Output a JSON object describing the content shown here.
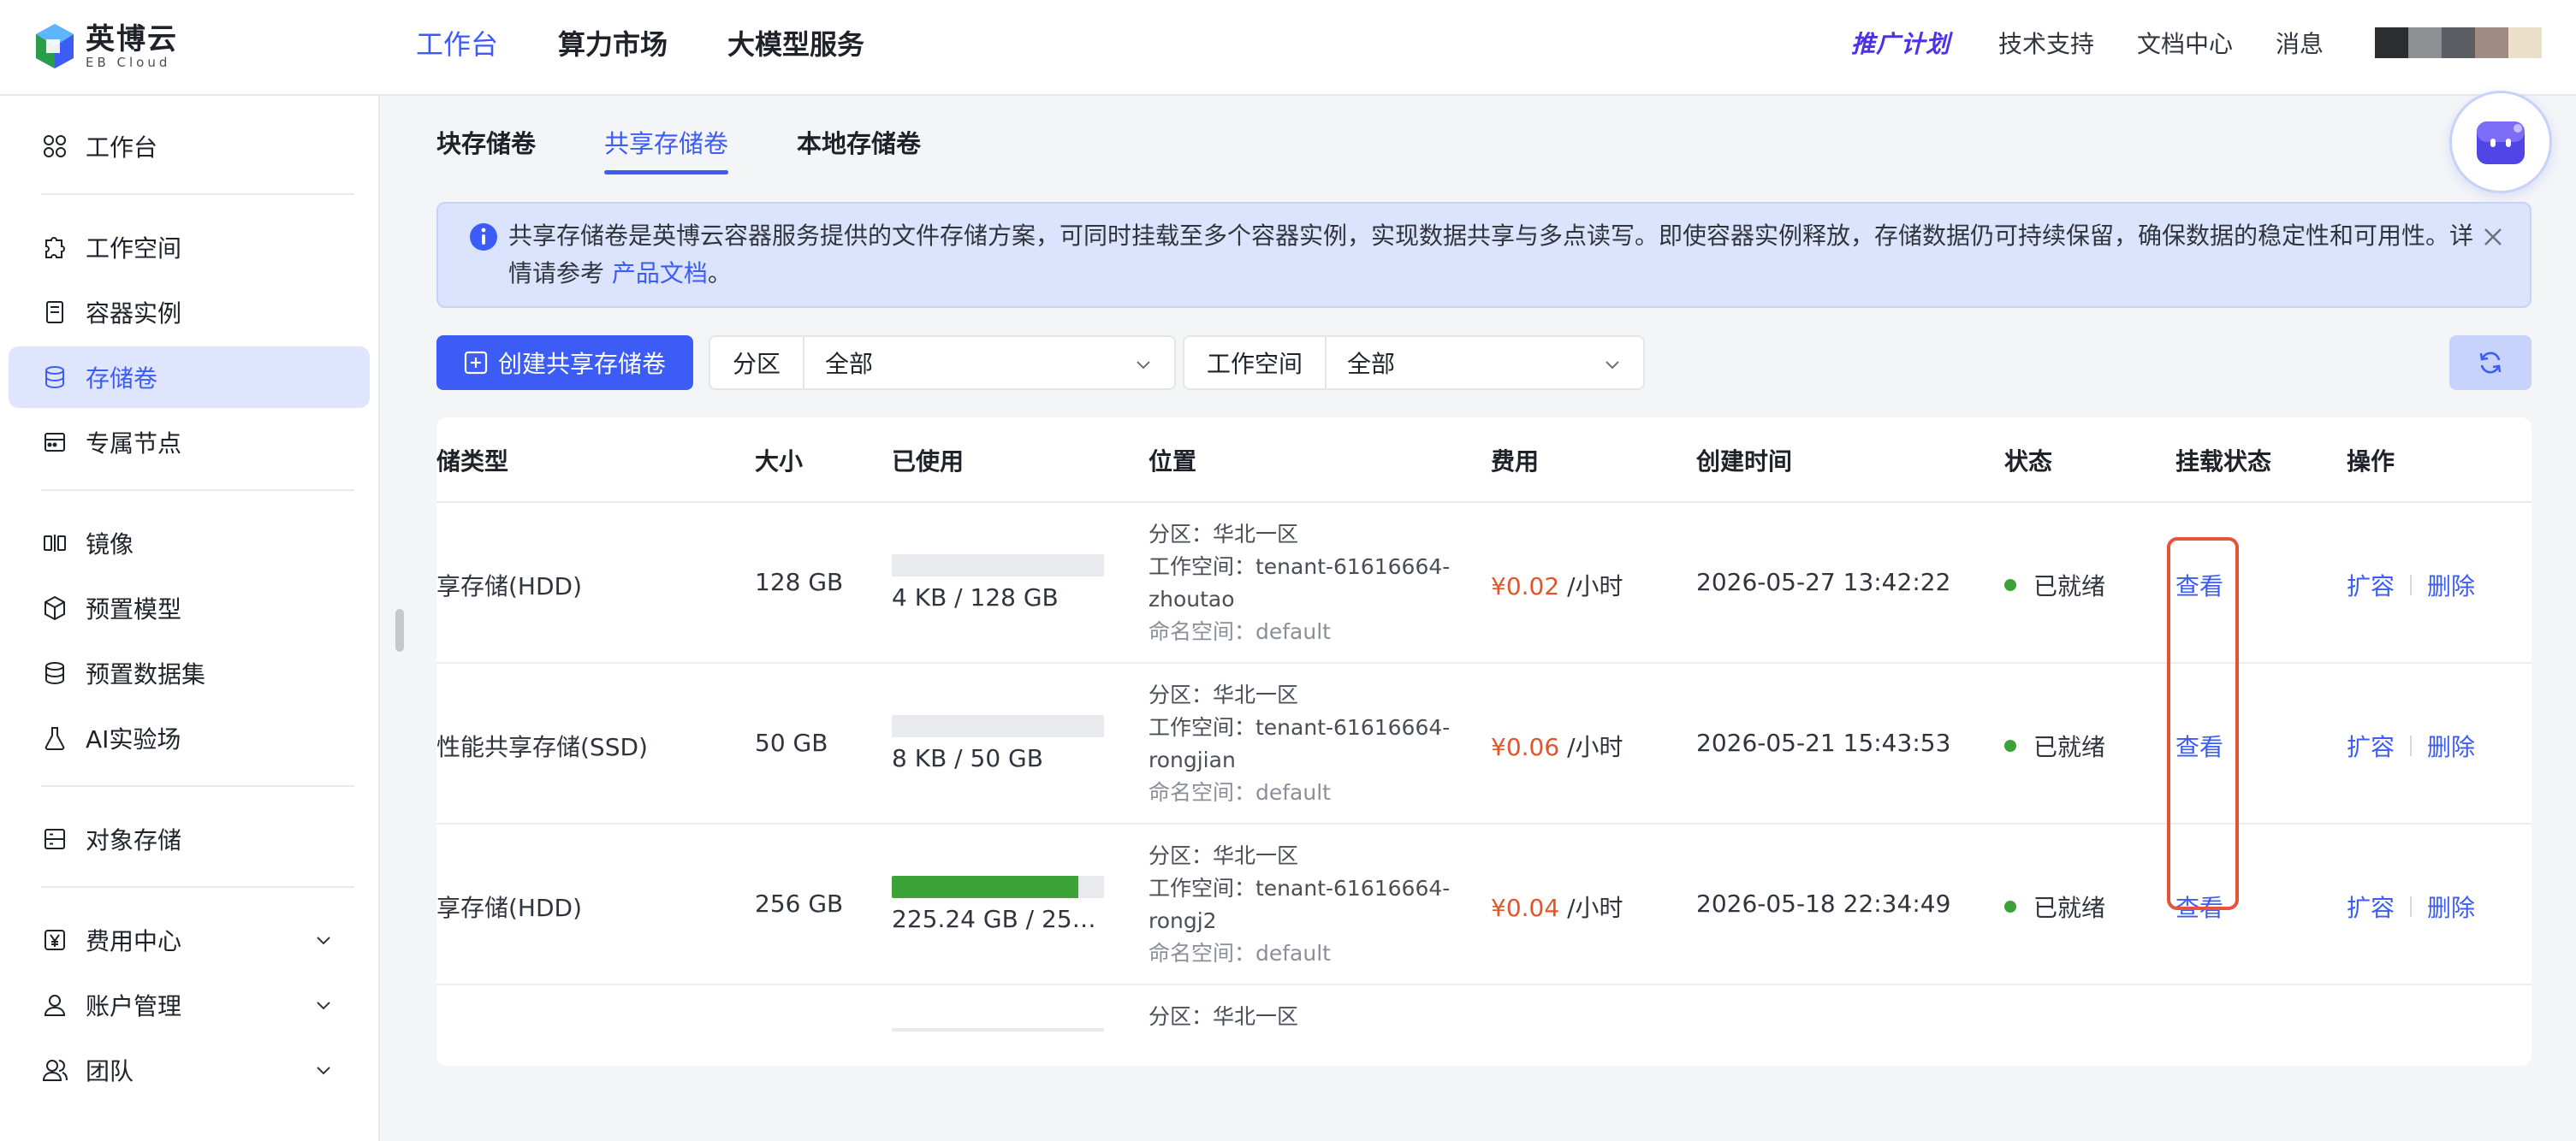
{
  "brand": {
    "name_cn": "英博云",
    "name_en": "EB Cloud",
    "colors": {
      "primary": "#3d5cf5",
      "success": "#3ba338",
      "price": "#e5532c",
      "highlight": "#e5533d"
    }
  },
  "header": {
    "nav": [
      "工作台",
      "算力市场",
      "大模型服务"
    ],
    "promo": "推广计划",
    "links": [
      "技术支持",
      "文档中心",
      "消息"
    ]
  },
  "sidebar": {
    "items": [
      {
        "label": "工作台",
        "icon": "dashboard-icon"
      },
      {
        "label": "工作空间",
        "icon": "puzzle-icon"
      },
      {
        "label": "容器实例",
        "icon": "container-icon"
      },
      {
        "label": "存储卷",
        "icon": "database-icon",
        "active": true
      },
      {
        "label": "专属节点",
        "icon": "node-icon"
      },
      {
        "label": "镜像",
        "icon": "image-icon"
      },
      {
        "label": "预置模型",
        "icon": "cube-icon"
      },
      {
        "label": "预置数据集",
        "icon": "dataset-icon"
      },
      {
        "label": "AI实验场",
        "icon": "flask-icon"
      },
      {
        "label": "对象存储",
        "icon": "object-storage-icon"
      },
      {
        "label": "费用中心",
        "icon": "yen-icon"
      },
      {
        "label": "账户管理",
        "icon": "user-icon"
      },
      {
        "label": "团队",
        "icon": "team-icon"
      }
    ]
  },
  "tabs": [
    "块存储卷",
    "共享存储卷",
    "本地存储卷"
  ],
  "notice": {
    "text": "共享存储卷是英博云容器服务提供的文件存储方案，可同时挂载至多个容器实例，实现数据共享与多点读写。即使容器实例释放，存储数据仍可持续保留，确保数据的稳定性和可用性。详情请参考 ",
    "link": "产品文档",
    "tail": "。"
  },
  "toolbar": {
    "create": "创建共享存储卷",
    "zone_label": "分区",
    "zone_value": "全部",
    "workspace_label": "工作空间",
    "workspace_value": "全部"
  },
  "table": {
    "columns": [
      "储类型",
      "大小",
      "已使用",
      "位置",
      "费用",
      "创建时间",
      "状态",
      "挂载状态",
      "操作"
    ],
    "rows": [
      {
        "type": "享存储(HDD)",
        "size": "128 GB",
        "used": "4 KB / 128 GB",
        "used_fraction": 0.0,
        "zone": "分区：华北一区",
        "workspace_a": "工作空间：tenant-61616664-",
        "workspace_b": "zhoutao",
        "namespace": "命名空间：default",
        "fee_amount": "¥0.02",
        "fee_unit": " /小时",
        "created": "2026-05-27 13:42:22",
        "status": "已就绪",
        "mount": "查看",
        "op_expand": "扩容",
        "op_delete": "删除"
      },
      {
        "type": "性能共享存储(SSD)",
        "size": "50 GB",
        "used": "8 KB / 50 GB",
        "used_fraction": 0.0,
        "zone": "分区：华北一区",
        "workspace_a": "工作空间：tenant-61616664-",
        "workspace_b": "rongjian",
        "namespace": "命名空间：default",
        "fee_amount": "¥0.06",
        "fee_unit": " /小时",
        "created": "2026-05-21 15:43:53",
        "status": "已就绪",
        "mount": "查看",
        "op_expand": "扩容",
        "op_delete": "删除"
      },
      {
        "type": "享存储(HDD)",
        "size": "256 GB",
        "used": "225.24 GB / 256 ...",
        "used_fraction": 0.88,
        "zone": "分区：华北一区",
        "workspace_a": "工作空间：tenant-61616664-",
        "workspace_b": "rongj2",
        "namespace": "命名空间：default",
        "fee_amount": "¥0.04",
        "fee_unit": " /小时",
        "created": "2026-05-18 22:34:49",
        "status": "已就绪",
        "mount": "查看",
        "op_expand": "扩容",
        "op_delete": "删除"
      }
    ],
    "partial_row_zone": "分区：华北一区"
  }
}
